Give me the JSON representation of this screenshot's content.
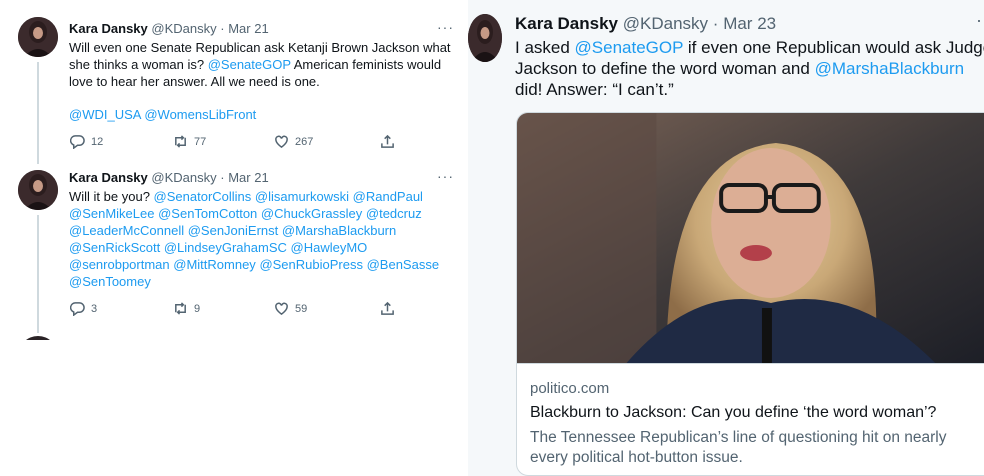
{
  "left": {
    "tweets": [
      {
        "name": "Kara Dansky",
        "handle": "@KDansky",
        "dot": "·",
        "date": "Mar 21",
        "more": "···",
        "text_parts": [
          "Will even one Senate Republican ask Ketanji Brown Jackson what she thinks a woman is? ",
          "@SenateGOP",
          " American feminists would love to hear her answer. All we need is one."
        ],
        "mentions": [
          "@WDI_USA",
          "@WomensLibFront"
        ],
        "replies": "12",
        "retweets": "77",
        "likes": "267"
      },
      {
        "name": "Kara Dansky",
        "handle": "@KDansky",
        "dot": "·",
        "date": "Mar 21",
        "more": "···",
        "lead": "Will it be you? ",
        "mentions": [
          "@SenatorCollins",
          "@lisamurkowski",
          "@RandPaul",
          "@SenMikeLee",
          "@SenTomCotton",
          "@ChuckGrassley",
          "@tedcruz",
          "@LeaderMcConnell",
          "@SenJoniErnst",
          "@MarshaBlackburn",
          "@SenRickScott",
          "@LindseyGrahamSC",
          "@HawleyMO",
          "@senrobportman",
          "@MittRomney",
          "@SenRubioPress",
          "@BenSasse",
          "@SenToomey"
        ],
        "replies": "3",
        "retweets": "9",
        "likes": "59"
      }
    ]
  },
  "right": {
    "name": "Kara Dansky",
    "handle": "@KDansky",
    "dot": "·",
    "date": "Mar 23",
    "text_parts": [
      "I asked ",
      "@SenateGOP",
      " if even one Republican would ask Judge Jackson to define the word woman and ",
      "@MarshaBlackburn",
      " did! Answer: “I can’t.”"
    ],
    "card": {
      "domain": "politico.com",
      "title": "Blackburn to Jackson: Can you define ‘the word woman’?",
      "description": "The Tennessee Republican’s line of questioning hit on nearly every political hot-button issue."
    }
  },
  "colors": {
    "link": "#1d9bf0",
    "text": "#0f1419",
    "secondary": "#536471",
    "border": "#cfd9de"
  },
  "icons": [
    "reply-icon",
    "retweet-icon",
    "like-icon",
    "share-icon",
    "more-icon"
  ]
}
